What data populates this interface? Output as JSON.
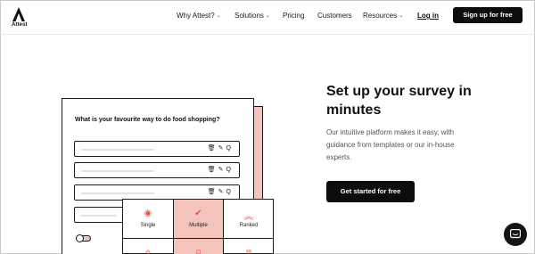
{
  "header": {
    "logo_text": "Attest",
    "nav": [
      {
        "label": "Why Attest?",
        "dropdown": true
      },
      {
        "label": "Solutions",
        "dropdown": true
      },
      {
        "label": "Pricing",
        "dropdown": false
      },
      {
        "label": "Customers",
        "dropdown": false
      },
      {
        "label": "Resources",
        "dropdown": true
      }
    ],
    "login_label": "Log in",
    "signup_label": "Sign up for free"
  },
  "hero": {
    "title": "Set up your survey in minutes",
    "description": "Our intuitive platform makes it easy, with guidance from templates or our in-house experts.",
    "cta_label": "Get started for free"
  },
  "illustration": {
    "question": "What is your favourite way to do food shopping?",
    "option_icons": [
      "trash-icon",
      "pin-icon",
      "search-icon"
    ],
    "question_types": [
      {
        "label": "Single",
        "icon": "radio-icon"
      },
      {
        "label": "Multiple",
        "icon": "check-icon"
      },
      {
        "label": "Ranked",
        "icon": "chevrons-up-icon"
      }
    ]
  },
  "colors": {
    "accent_pink": "#f3c3bc",
    "accent_red": "#d9574b",
    "button_dark": "#0d0d0d"
  }
}
